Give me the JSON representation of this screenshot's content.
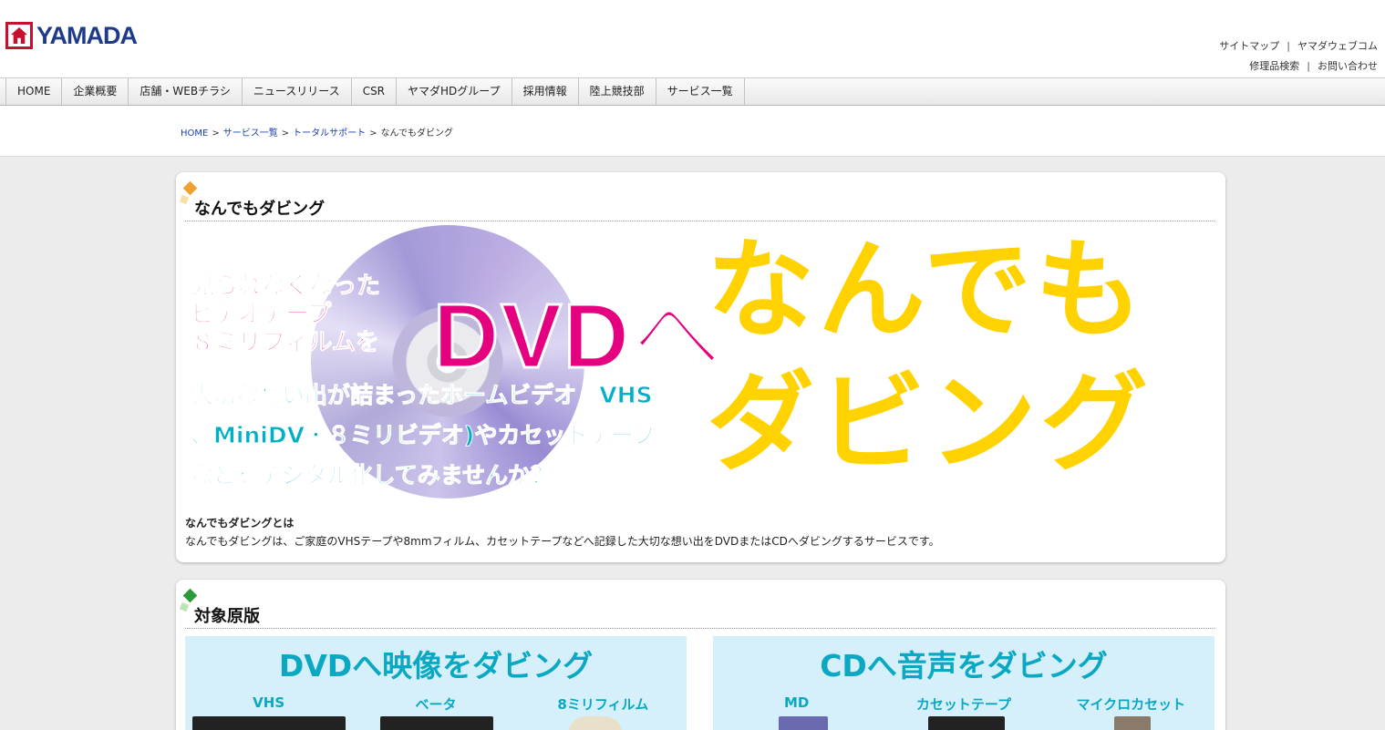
{
  "header": {
    "logo_text": "YAMADA",
    "util_links": [
      "サイトマップ",
      "ヤマダウェブコム",
      "修理品検索",
      "お問い合わせ"
    ],
    "separator": "|"
  },
  "nav": {
    "items": [
      "HOME",
      "企業概要",
      "店舗・WEBチラシ",
      "ニュースリリース",
      "CSR",
      "ヤマダHDグループ",
      "採用情報",
      "陸上競技部",
      "サービス一覧"
    ]
  },
  "breadcrumb": {
    "items": [
      "HOME",
      "サービス一覧",
      "トータルサポート",
      "なんでもダビング"
    ],
    "separator": ">"
  },
  "section1": {
    "title": "なんでもダビング",
    "hero": {
      "pink_lines": [
        "見られなくなった",
        "ビデオテープ",
        "８ミリフィルムを"
      ],
      "dvd_text": "DVDへ",
      "cyan_lines": [
        "大切な想い出が詰まったホームビデオ（VHS",
        "、MiniDV・８ミリビデオ)やカセットテープ",
        "などをデジタル化してみませんか？"
      ],
      "big_lines": [
        "なんでも",
        "ダビング"
      ]
    },
    "desc_heading": "なんでもダビングとは",
    "desc_body": "なんでもダビングは、ご家庭のVHSテープや8mmフィルム、カセットテープなどへ記録した大切な想い出をDVDまたはCDへダビングするサービスです。"
  },
  "section2": {
    "title": "対象原版",
    "video_box": {
      "title": "DVDへ映像をダビング",
      "labels": [
        "VHS",
        "ベータ",
        "8ミリフィルム"
      ]
    },
    "audio_box": {
      "title": "CDへ音声をダビング",
      "labels": [
        "MD",
        "カセットテープ",
        "マイクロカセット"
      ]
    }
  },
  "colors": {
    "brand_red": "#c8102e",
    "brand_navy": "#1e3a8a",
    "hero_pink": "#e4007f",
    "hero_cyan": "#00b0c8",
    "hero_yellow": "#ffd200",
    "diamond_orange": "#f0a030",
    "diamond_green": "#2a9a3a"
  }
}
